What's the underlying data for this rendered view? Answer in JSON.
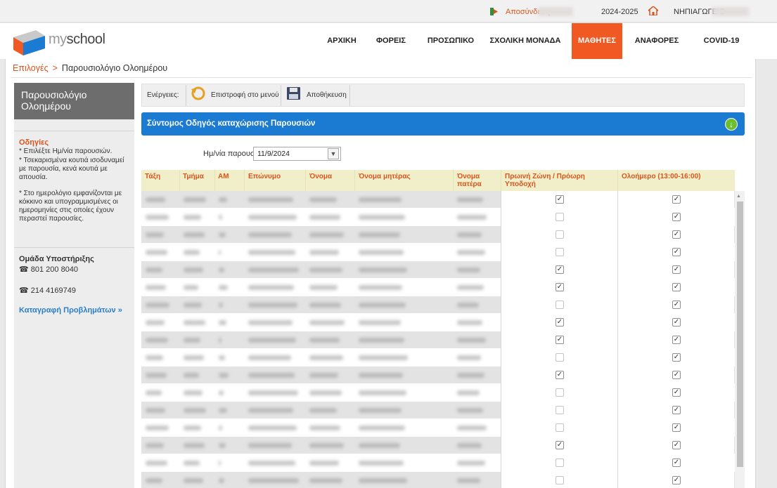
{
  "topbar": {
    "logout_label": "Αποσύνδεση",
    "school_year": "2024-2025",
    "school_name": "ΝΗΠΙΑΓΩΓΕΙΟ"
  },
  "brand": {
    "logo_my": "my",
    "logo_school": "school"
  },
  "nav": {
    "items": [
      {
        "label": "ΑΡΧΙΚΗ"
      },
      {
        "label": "ΦΟΡΕΙΣ"
      },
      {
        "label": "ΠΡΟΣΩΠΙΚΟ"
      },
      {
        "label": "ΣΧΟΛΙΚΗ ΜΟΝΑΔΑ"
      },
      {
        "label": "ΜΑΘΗΤΕΣ",
        "active": true
      },
      {
        "label": "ΑΝΑΦΟΡΕΣ"
      },
      {
        "label": "COVID-19"
      }
    ]
  },
  "breadcrumb": {
    "link": "Επιλογές",
    "separator": ">",
    "current": "Παρουσιολόγιο Ολοημέρου"
  },
  "sidebar": {
    "title_line1": "Παρουσιολόγιο",
    "title_line2": "Ολοημέρου",
    "instructions_heading": "Οδηγίες",
    "instructions": [
      "* Επιλέξτε Ημ/νία παρουσιών.",
      "* Τσεκαρισμένα κουτιά ισοδυναμεί με παρουσία, κενά κουτιά με απουσία.",
      "* Στο ημερολόγιο εμφανίζονται με κόκκινο και υπογραμμισμένες οι ημερομηνίες στις οποίες έχουν περαστεί παρουσίες."
    ],
    "support_heading": "Ομάδα Υποστήριξης",
    "phone1": "801 200 8040",
    "phone2": "214 4169749",
    "report_link": "Καταγραφή Προβλημάτων »"
  },
  "actions": {
    "label": "Ενέργειες:",
    "back_label": "Επιστροφή στο μενού",
    "save_label": "Αποθήκευση"
  },
  "guide": {
    "title": "Σύντομος Οδηγός καταχώρισης Παρουσιών",
    "expand_icon": "arrow-down-circle-icon"
  },
  "date": {
    "label": "Ημ/νία παρουσιών",
    "value": "11/9/2024"
  },
  "table": {
    "headers": {
      "class": "Τάξη",
      "section": "Τμήμα",
      "am": "ΑΜ",
      "surname": "Επώνυμο",
      "name": "Όνομα",
      "mother": "Όνομα μητέρας",
      "father_l1": "Όνομα",
      "father_l2": "πατέρα",
      "early_l1": "Πρωινή Ζώνη / Πρόωρη",
      "early_l2": "Υποδοχή",
      "allday": "Ολοήμερο (13:00-16:00)"
    },
    "rows": [
      {
        "early": true,
        "allday": true
      },
      {
        "early": false,
        "allday": true
      },
      {
        "early": false,
        "allday": true
      },
      {
        "early": false,
        "allday": true
      },
      {
        "early": true,
        "allday": true
      },
      {
        "early": true,
        "allday": true
      },
      {
        "early": false,
        "allday": true
      },
      {
        "early": true,
        "allday": true
      },
      {
        "early": true,
        "allday": true
      },
      {
        "early": false,
        "allday": true
      },
      {
        "early": true,
        "allday": true
      },
      {
        "early": false,
        "allday": true
      },
      {
        "early": false,
        "allday": true
      },
      {
        "early": false,
        "allday": true
      },
      {
        "early": true,
        "allday": true
      },
      {
        "early": false,
        "allday": true
      },
      {
        "early": false,
        "allday": true
      }
    ]
  }
}
